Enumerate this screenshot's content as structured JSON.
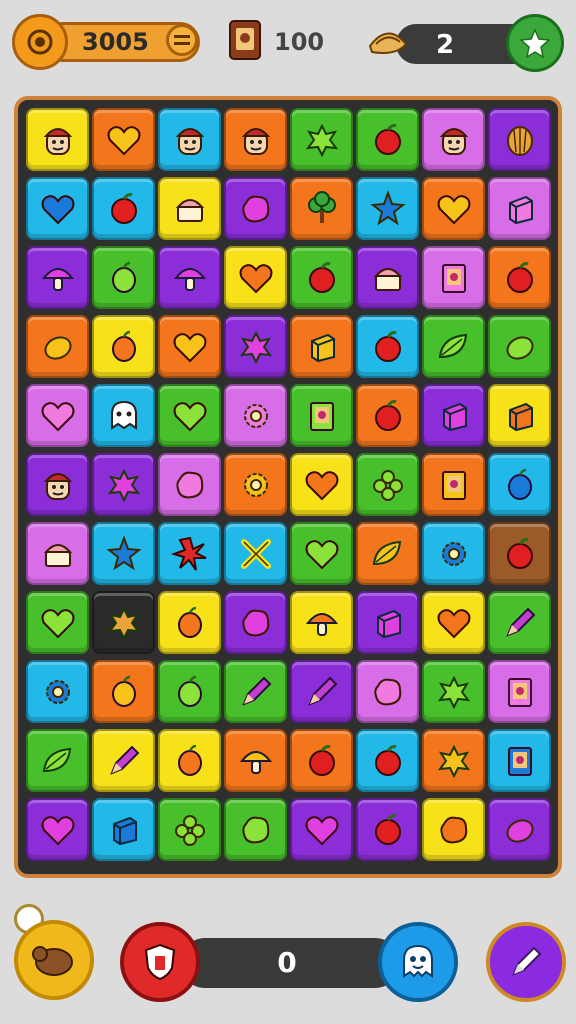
{
  "hud": {
    "coins": "3005",
    "coins_plus_icon": "equals-icon",
    "books": "100",
    "pies": "2",
    "star_icon": "star-icon"
  },
  "bottom": {
    "score": "0"
  },
  "colors": {
    "red": "#e8322e",
    "orange": "#f3761c",
    "yellow": "#f7e21a",
    "green": "#48c02c",
    "cyan": "#22b8e8",
    "purple": "#8b2ed8",
    "pink": "#d76ee8",
    "brown": "#9a5a2a"
  },
  "board": {
    "rows": [
      [
        {
          "bg": "yellow",
          "icon": "face"
        },
        {
          "bg": "orange",
          "icon": "heart"
        },
        {
          "bg": "cyan",
          "icon": "face"
        },
        {
          "bg": "orange",
          "icon": "face"
        },
        {
          "bg": "green",
          "icon": "splash"
        },
        {
          "bg": "green",
          "icon": "apple"
        },
        {
          "bg": "pink",
          "icon": "face"
        },
        {
          "bg": "purple",
          "icon": "shell"
        }
      ],
      [
        {
          "bg": "cyan",
          "icon": "heart"
        },
        {
          "bg": "cyan",
          "icon": "apple"
        },
        {
          "bg": "yellow",
          "icon": "cake"
        },
        {
          "bg": "purple",
          "icon": "blob"
        },
        {
          "bg": "orange",
          "icon": "tree"
        },
        {
          "bg": "cyan",
          "icon": "star"
        },
        {
          "bg": "orange",
          "icon": "heart"
        },
        {
          "bg": "pink",
          "icon": "cube"
        }
      ],
      [
        {
          "bg": "purple",
          "icon": "mushroom"
        },
        {
          "bg": "green",
          "icon": "plum"
        },
        {
          "bg": "purple",
          "icon": "mushroom"
        },
        {
          "bg": "yellow",
          "icon": "heart"
        },
        {
          "bg": "green",
          "icon": "apple"
        },
        {
          "bg": "purple",
          "icon": "cake"
        },
        {
          "bg": "pink",
          "icon": "book"
        },
        {
          "bg": "orange",
          "icon": "apple"
        }
      ],
      [
        {
          "bg": "orange",
          "icon": "lemon"
        },
        {
          "bg": "yellow",
          "icon": "plum"
        },
        {
          "bg": "orange",
          "icon": "heart"
        },
        {
          "bg": "purple",
          "icon": "splash"
        },
        {
          "bg": "orange",
          "icon": "cube"
        },
        {
          "bg": "cyan",
          "icon": "apple"
        },
        {
          "bg": "green",
          "icon": "leaf"
        },
        {
          "bg": "green",
          "icon": "lemon"
        }
      ],
      [
        {
          "bg": "pink",
          "icon": "heart"
        },
        {
          "bg": "cyan",
          "icon": "ghost"
        },
        {
          "bg": "green",
          "icon": "heart"
        },
        {
          "bg": "pink",
          "icon": "gear"
        },
        {
          "bg": "green",
          "icon": "book"
        },
        {
          "bg": "orange",
          "icon": "apple"
        },
        {
          "bg": "purple",
          "icon": "cube"
        },
        {
          "bg": "yellow",
          "icon": "cube"
        }
      ],
      [
        {
          "bg": "purple",
          "icon": "face"
        },
        {
          "bg": "purple",
          "icon": "splash"
        },
        {
          "bg": "pink",
          "icon": "blob"
        },
        {
          "bg": "orange",
          "icon": "gear"
        },
        {
          "bg": "yellow",
          "icon": "heart"
        },
        {
          "bg": "green",
          "icon": "clover"
        },
        {
          "bg": "orange",
          "icon": "book"
        },
        {
          "bg": "cyan",
          "icon": "plum"
        }
      ],
      [
        {
          "bg": "pink",
          "icon": "cake"
        },
        {
          "bg": "cyan",
          "icon": "star"
        },
        {
          "bg": "cyan",
          "icon": "burst"
        },
        {
          "bg": "cyan",
          "icon": "cross"
        },
        {
          "bg": "green",
          "icon": "heart"
        },
        {
          "bg": "orange",
          "icon": "leaf"
        },
        {
          "bg": "cyan",
          "icon": "gear"
        },
        {
          "bg": "brown",
          "icon": "apple"
        }
      ],
      [
        {
          "bg": "green",
          "icon": "heart"
        },
        {
          "bg": "black",
          "icon": "splash"
        },
        {
          "bg": "yellow",
          "icon": "plum"
        },
        {
          "bg": "purple",
          "icon": "blob"
        },
        {
          "bg": "yellow",
          "icon": "mushroom"
        },
        {
          "bg": "purple",
          "icon": "cube"
        },
        {
          "bg": "yellow",
          "icon": "heart"
        },
        {
          "bg": "green",
          "icon": "pencil"
        }
      ],
      [
        {
          "bg": "cyan",
          "icon": "gear"
        },
        {
          "bg": "orange",
          "icon": "plum"
        },
        {
          "bg": "green",
          "icon": "plum"
        },
        {
          "bg": "green",
          "icon": "pencil"
        },
        {
          "bg": "purple",
          "icon": "pencil"
        },
        {
          "bg": "pink",
          "icon": "blob"
        },
        {
          "bg": "green",
          "icon": "splash"
        },
        {
          "bg": "pink",
          "icon": "book"
        }
      ],
      [
        {
          "bg": "green",
          "icon": "leaf"
        },
        {
          "bg": "yellow",
          "icon": "pencil"
        },
        {
          "bg": "yellow",
          "icon": "plum"
        },
        {
          "bg": "orange",
          "icon": "mushroom"
        },
        {
          "bg": "orange",
          "icon": "apple"
        },
        {
          "bg": "cyan",
          "icon": "apple"
        },
        {
          "bg": "orange",
          "icon": "splash"
        },
        {
          "bg": "cyan",
          "icon": "book"
        }
      ],
      [
        {
          "bg": "purple",
          "icon": "heart"
        },
        {
          "bg": "cyan",
          "icon": "cube"
        },
        {
          "bg": "green",
          "icon": "clover"
        },
        {
          "bg": "green",
          "icon": "blob"
        },
        {
          "bg": "purple",
          "icon": "heart"
        },
        {
          "bg": "purple",
          "icon": "apple"
        },
        {
          "bg": "yellow",
          "icon": "blob"
        },
        {
          "bg": "purple",
          "icon": "lemon"
        }
      ]
    ]
  }
}
